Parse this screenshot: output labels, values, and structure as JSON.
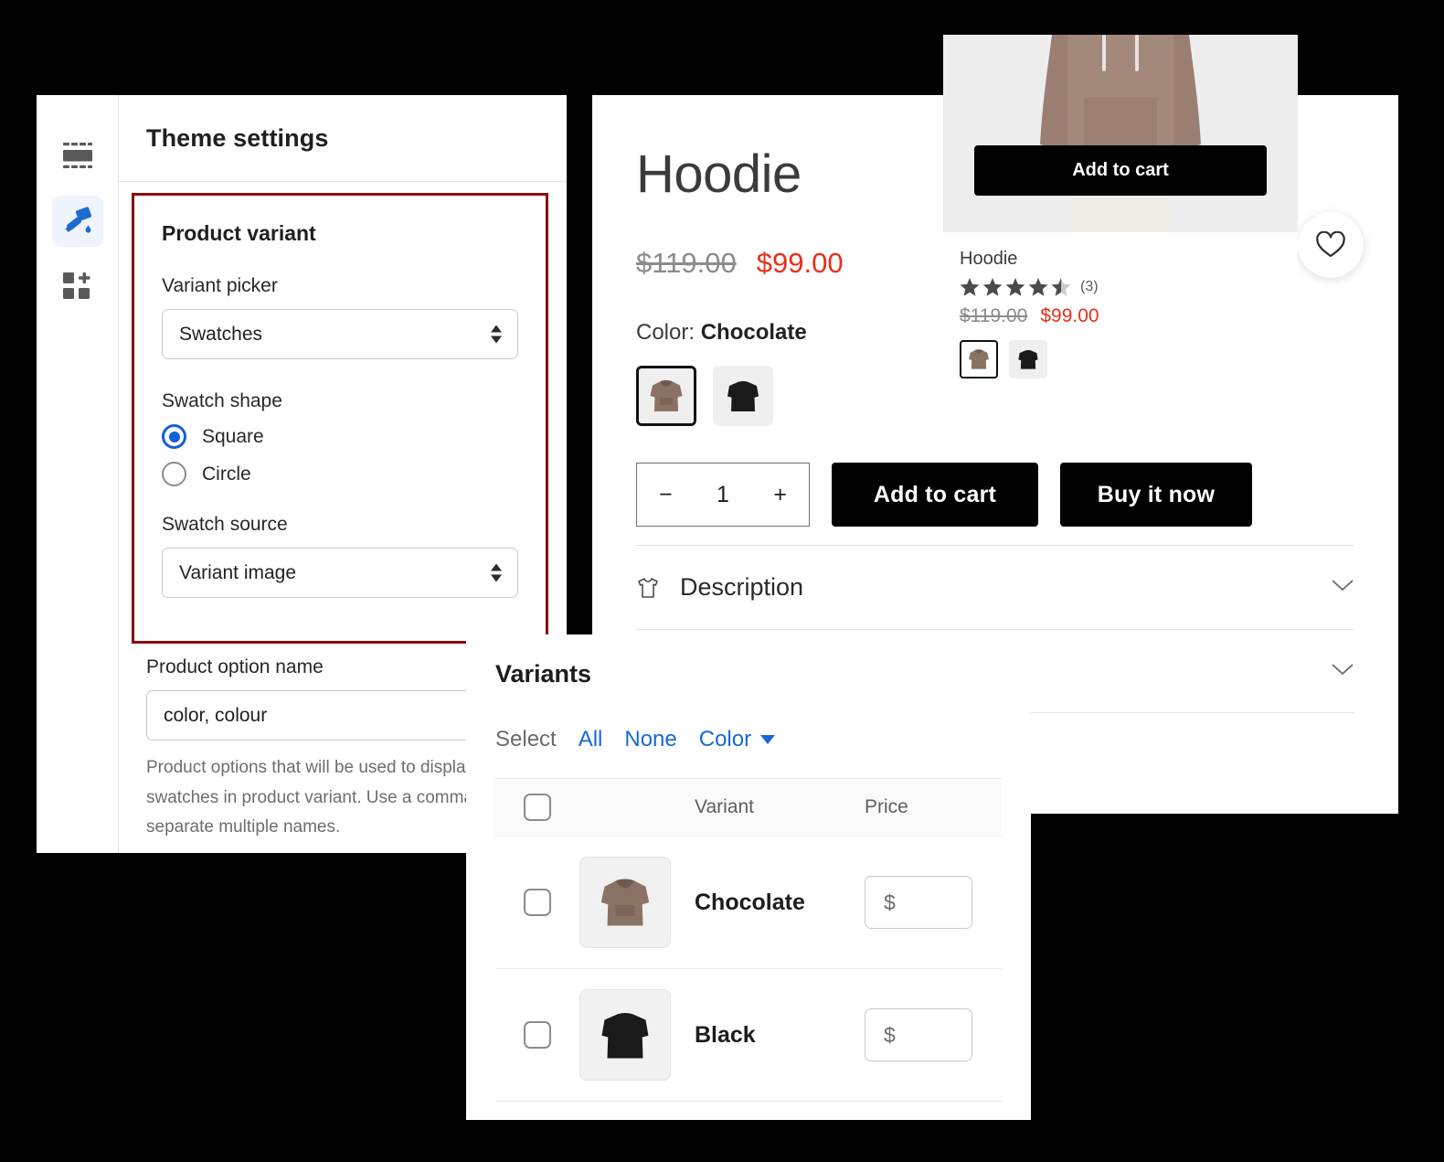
{
  "theme_settings": {
    "title": "Theme settings",
    "rail": [
      {
        "name": "sections-icon",
        "label": "Sections"
      },
      {
        "name": "paint-roller-icon",
        "label": "Theme settings"
      },
      {
        "name": "add-block-icon",
        "label": "Add block"
      }
    ],
    "highlight_color": "#8b0d10",
    "section": {
      "heading": "Product variant",
      "variant_picker_label": "Variant picker",
      "variant_picker_value": "Swatches",
      "swatch_shape_label": "Swatch shape",
      "swatch_shape_options": [
        {
          "label": "Square",
          "selected": true
        },
        {
          "label": "Circle",
          "selected": false
        }
      ],
      "swatch_source_label": "Swatch source",
      "swatch_source_value": "Variant image"
    },
    "option_name_label": "Product option name",
    "option_name_value": "color, colour",
    "option_name_help": "Product options that will be used to display swatches in product variant. Use a comma (,) to separate multiple names."
  },
  "product_page": {
    "title": "Hoodie",
    "price_compare": "$119.00",
    "price_current": "$99.00",
    "color_prefix": "Color:",
    "color_value": "Chocolate",
    "swatches": [
      {
        "name": "Chocolate",
        "selected": true
      },
      {
        "name": "Black",
        "selected": false
      }
    ],
    "quantity_minus": "−",
    "quantity_value": "1",
    "quantity_plus": "+",
    "add_to_cart_label": "Add to cart",
    "buy_now_label": "Buy it now",
    "accordions": [
      {
        "label": "Description",
        "icon": "tshirt-icon"
      },
      {
        "label": "",
        "icon": ""
      }
    ],
    "wishlist_icon": "heart-icon"
  },
  "product_card": {
    "add_to_cart_label": "Add to cart",
    "title": "Hoodie",
    "rating": 4.5,
    "rating_stars": "★★★★",
    "review_count": "(3)",
    "price_compare": "$119.00",
    "price_current": "$99.00",
    "swatches": [
      {
        "name": "Chocolate",
        "selected": true
      },
      {
        "name": "Black",
        "selected": false
      }
    ]
  },
  "variants_panel": {
    "title": "Variants",
    "select_label": "Select",
    "select_all": "All",
    "select_none": "None",
    "filter_label": "Color",
    "columns": {
      "variant": "Variant",
      "price": "Price"
    },
    "rows": [
      {
        "name": "Chocolate",
        "price_symbol": "$",
        "color": "chocolate"
      },
      {
        "name": "Black",
        "price_symbol": "$",
        "color": "black"
      }
    ]
  },
  "colors": {
    "accent_blue": "#1769d6",
    "sale_red": "#e8301a",
    "highlight_red": "#8b0d10",
    "chocolate": "#8a7264",
    "black": "#1a1a1a"
  }
}
